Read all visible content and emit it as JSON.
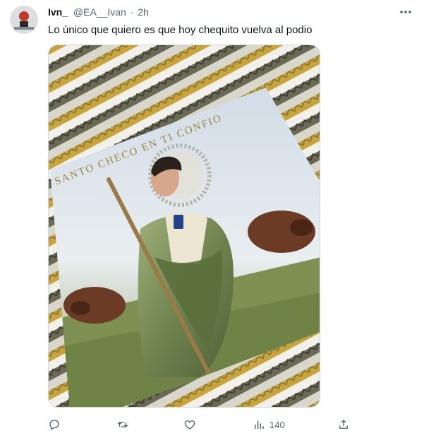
{
  "tweet": {
    "author_name": "Ivn_",
    "handle": "@EA__Ivan",
    "separator": "·",
    "timestamp": "2h",
    "text": "Lo único que quiero es que hoy chequito vuelva al podio",
    "image": {
      "card_caption": "SANTO CHECO EN TI CONFIO"
    },
    "actions": {
      "reply_icon": "reply-icon",
      "retweet_icon": "retweet-icon",
      "like_icon": "heart-icon",
      "views_icon": "views-chart-icon",
      "views_count": "140",
      "share_icon": "share-icon"
    }
  }
}
